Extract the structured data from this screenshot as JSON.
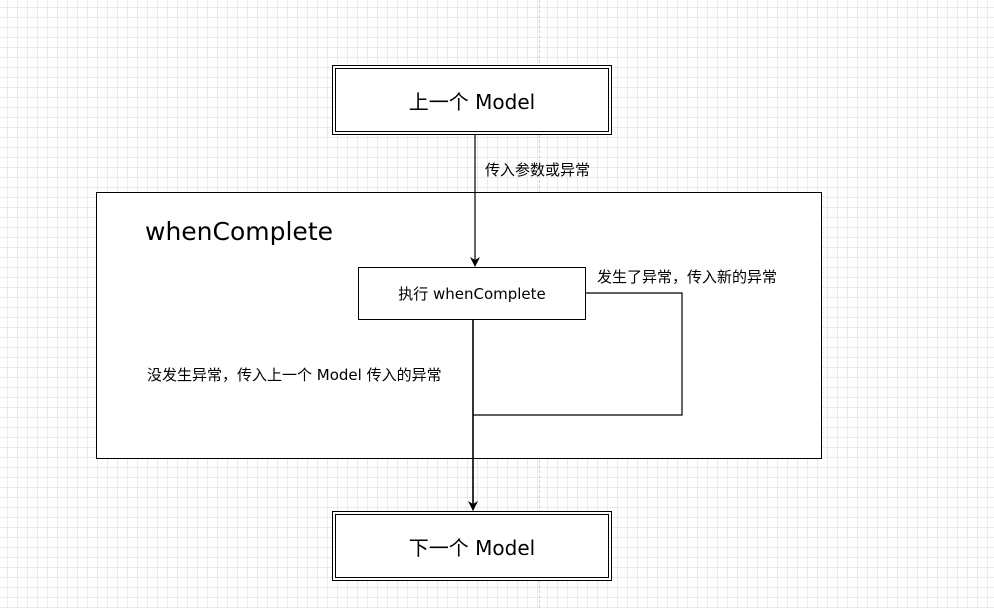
{
  "nodes": {
    "prev_model": "上一个 Model",
    "next_model": "下一个 Model",
    "container_title": "whenComplete",
    "exec_box": "执行 whenComplete"
  },
  "edges": {
    "pass_label": "传入参数或异常",
    "exception_label": "发生了异常，传入新的异常",
    "no_exception_label": "没发生异常，传入上一个 Model 传入的异常"
  },
  "colors": {
    "stroke": "#000000",
    "grid": "#ebebeb",
    "background": "#ffffff"
  }
}
